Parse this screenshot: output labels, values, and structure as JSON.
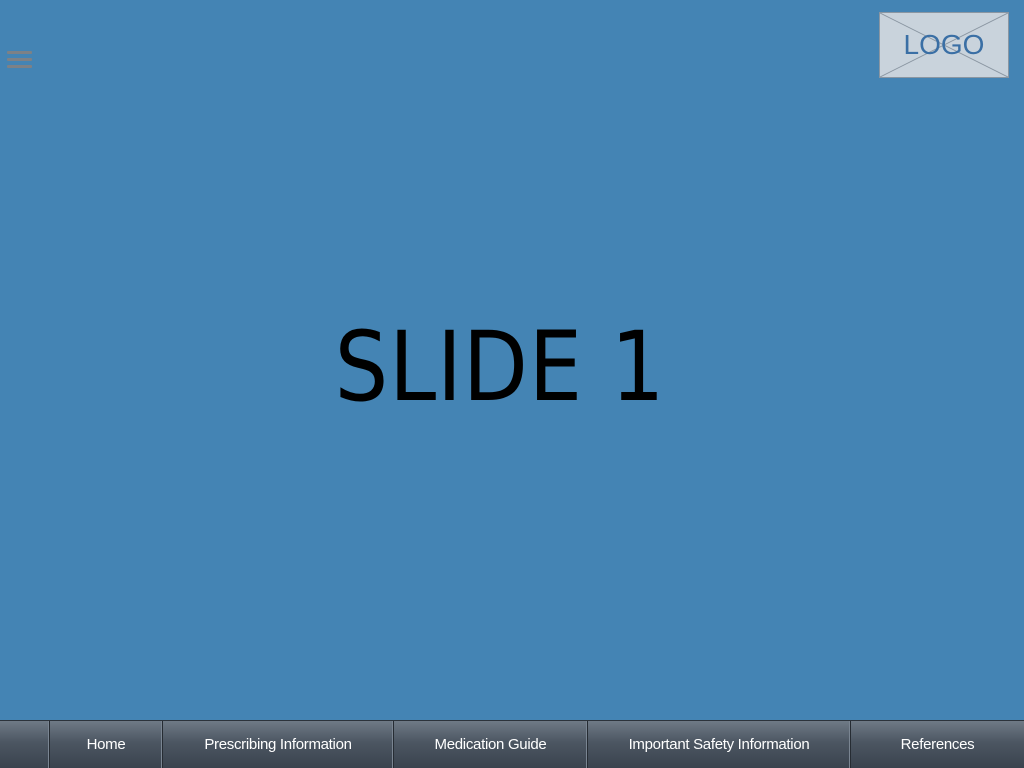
{
  "header": {
    "menu_icon": "hamburger-menu-icon",
    "logo_text": "LOGO"
  },
  "slide": {
    "title": "SLIDE 1"
  },
  "nav": {
    "items": [
      {
        "label": "Home"
      },
      {
        "label": "Prescribing Information"
      },
      {
        "label": "Medication Guide"
      },
      {
        "label": "Important Safety Information"
      },
      {
        "label": "References"
      }
    ]
  },
  "colors": {
    "background": "#4484b4",
    "nav_bar": "#4c5662",
    "logo_box": "#c9d3dc",
    "logo_text": "#3a6fa5"
  }
}
